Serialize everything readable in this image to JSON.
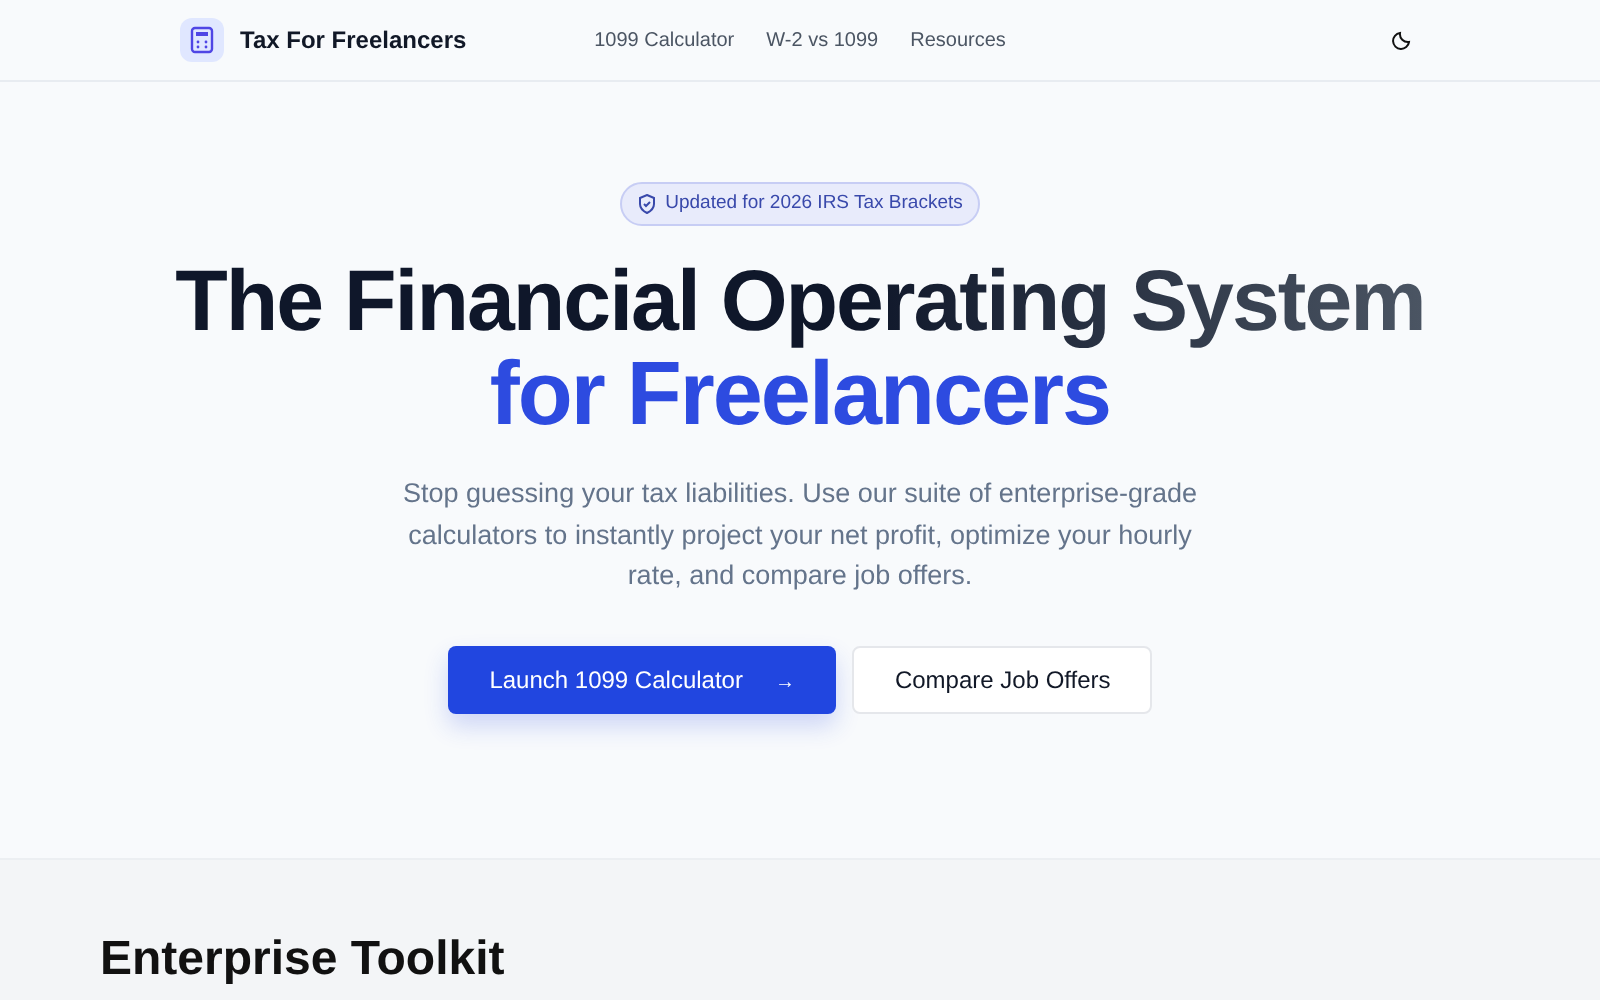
{
  "navbar": {
    "brand": "Tax For Freelancers",
    "links": [
      {
        "label": "1099 Calculator"
      },
      {
        "label": "W-2 vs 1099"
      },
      {
        "label": "Resources"
      }
    ]
  },
  "hero": {
    "badge": "Updated for 2026 IRS Tax Brackets",
    "headline": "The Financial Operating System",
    "headline_accent": "for Freelancers",
    "subtitle": "Stop guessing your tax liabilities. Use our suite of enterprise-grade calculators to instantly project your net profit, optimize your hourly rate, and compare job offers.",
    "buttons": [
      {
        "label": "Launch 1099 Calculator",
        "kind": "primary",
        "arrow": "→"
      },
      {
        "label": "Compare Job Offers",
        "kind": "secondary"
      }
    ]
  },
  "section": {
    "title": "Enterprise Toolkit"
  }
}
